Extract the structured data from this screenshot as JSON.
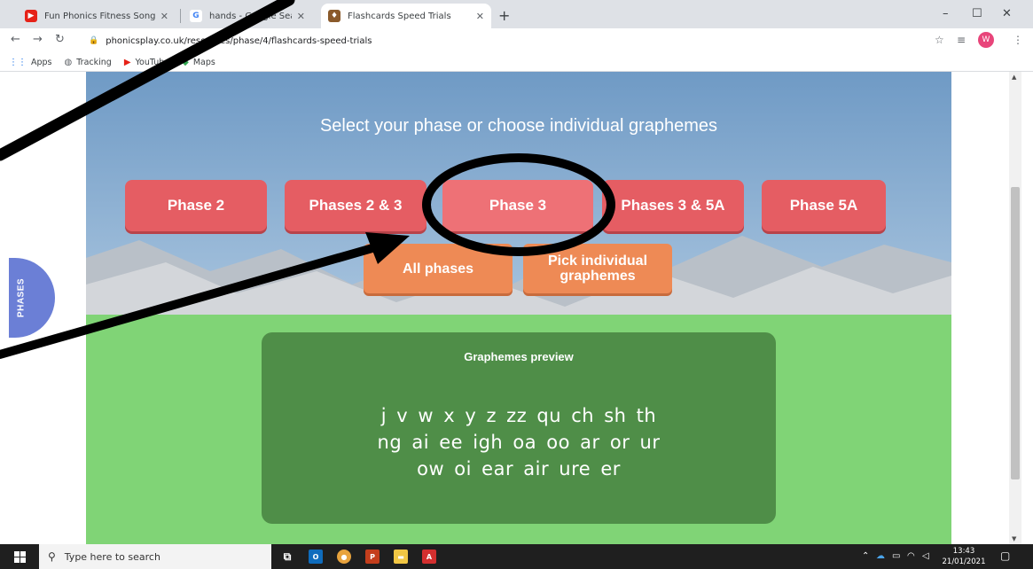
{
  "browser": {
    "tabs": [
      {
        "title": "Fun Phonics Fitness Song | Letter",
        "close": "✕",
        "favicon_color": "#e62117"
      },
      {
        "title": "hands - Google Search",
        "close": "✕",
        "favicon_color": "#4285f4"
      },
      {
        "title": "Flashcards Speed Trials",
        "close": "✕",
        "favicon_color": "#8a5a2b"
      }
    ],
    "new_tab": "+",
    "address": "phonicsplay.co.uk/resources/phase/4/flashcards-speed-trials",
    "profile_initial": "W",
    "window": {
      "minimize": "–",
      "maximize": "☐",
      "close": "✕"
    },
    "bookmarks": [
      {
        "label": "Apps",
        "icon": "apps-grid-icon"
      },
      {
        "label": "Tracking",
        "icon": "globe-icon"
      },
      {
        "label": "YouTube",
        "icon": "youtube-icon"
      },
      {
        "label": "Maps",
        "icon": "maps-icon"
      }
    ]
  },
  "page": {
    "heading": "Select your phase or choose individual graphemes",
    "phase_buttons": [
      {
        "label": "Phase 2"
      },
      {
        "label": "Phases 2 & 3"
      },
      {
        "label": "Phase 3",
        "selected": true
      },
      {
        "label": "Phases 3 & 5A"
      },
      {
        "label": "Phase 5A"
      }
    ],
    "option_buttons": [
      {
        "label": "All phases"
      },
      {
        "label": "Pick individual graphemes"
      }
    ],
    "side_tab": "PHASES",
    "preview": {
      "title": "Graphemes preview",
      "lines": [
        "j v w x y z zz qu ch sh th",
        "ng ai ee igh oa oo ar or ur",
        "ow oi ear air ure er"
      ]
    },
    "colors": {
      "phase_button": "#e55d63",
      "option_button": "#ee8a55",
      "preview_bg": "#4f8e48",
      "sky": "#7aa3cc",
      "grass": "#80d476",
      "side_tab": "#6b7fd6"
    }
  },
  "taskbar": {
    "search_placeholder": "Type here to search",
    "time": "13:43",
    "date": "21/01/2021"
  }
}
